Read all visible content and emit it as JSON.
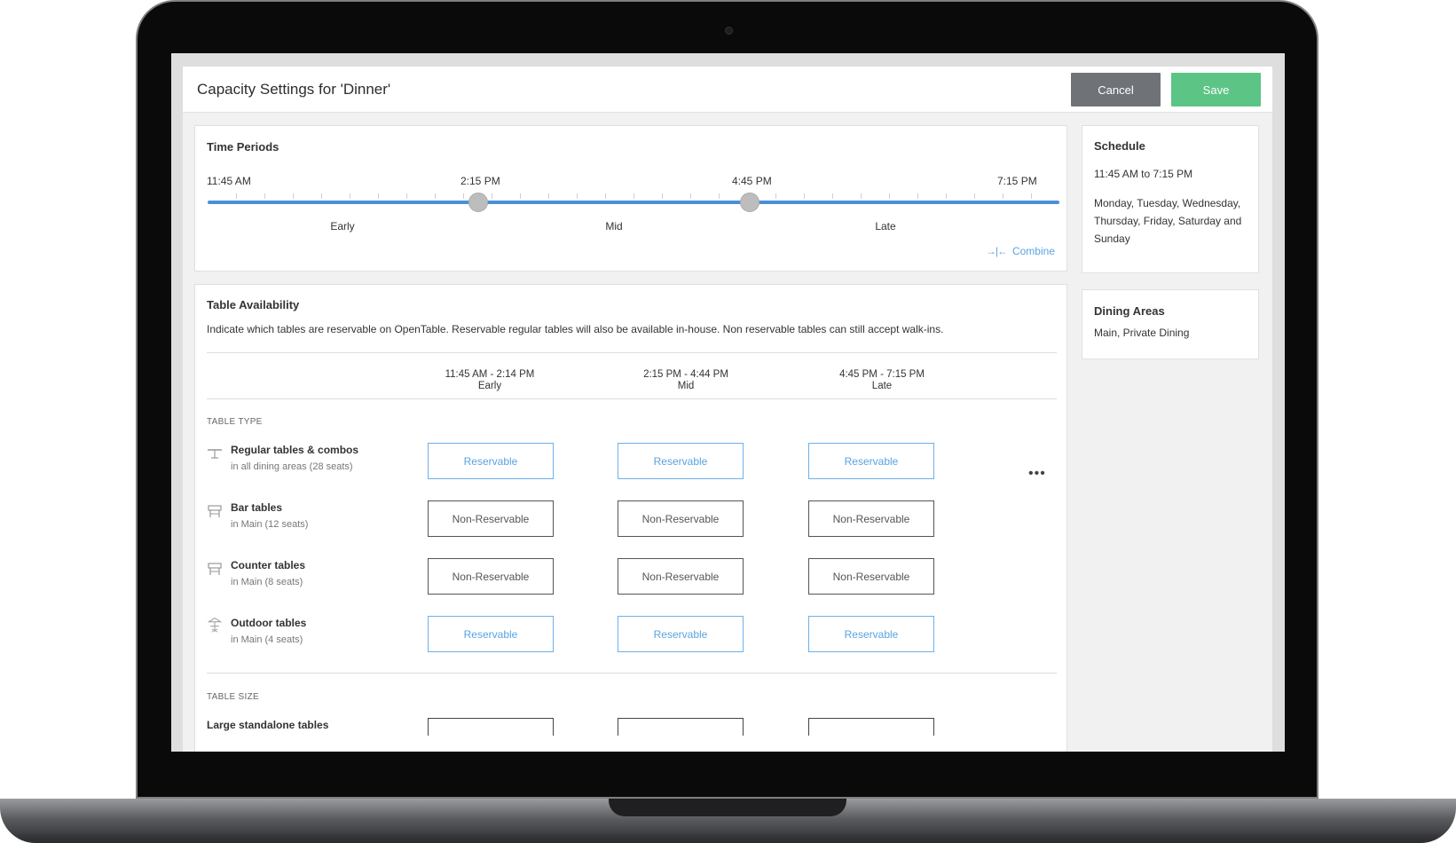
{
  "header": {
    "title": "Capacity Settings for 'Dinner'",
    "cancel_label": "Cancel",
    "save_label": "Save"
  },
  "time_periods": {
    "title": "Time Periods",
    "start_label": "11:45 AM",
    "handle1_label": "2:15 PM",
    "handle2_label": "4:45 PM",
    "end_label": "7:15 PM",
    "periods": [
      "Early",
      "Mid",
      "Late"
    ],
    "combine_label": "Combine"
  },
  "schedule": {
    "title": "Schedule",
    "time_range": "11:45 AM to 7:15 PM",
    "days_line1": "Monday, Tuesday, Wednesday,",
    "days_line2": "Thursday, Friday, Saturday and",
    "days_line3": "Sunday"
  },
  "dining_areas": {
    "title": "Dining Areas",
    "value": "Main, Private Dining"
  },
  "table_availability": {
    "title": "Table Availability",
    "description": "Indicate which tables are reservable on OpenTable. Reservable regular tables will also be available in-house. Non reservable tables can still accept walk-ins.",
    "columns": [
      {
        "time": "11:45 AM - 2:14 PM",
        "period": "Early"
      },
      {
        "time": "2:15 PM - 4:44 PM",
        "period": "Mid"
      },
      {
        "time": "4:45 PM - 7:15 PM",
        "period": "Late"
      }
    ],
    "table_type_label": "TABLE TYPE",
    "rows": [
      {
        "name": "Regular tables & combos",
        "sub": "in all dining areas (28 seats)",
        "values": [
          "Reservable",
          "Reservable",
          "Reservable"
        ]
      },
      {
        "name": "Bar tables",
        "sub": "in Main (12 seats)",
        "values": [
          "Non-Reservable",
          "Non-Reservable",
          "Non-Reservable"
        ]
      },
      {
        "name": "Counter tables",
        "sub": "in Main (8 seats)",
        "values": [
          "Non-Reservable",
          "Non-Reservable",
          "Non-Reservable"
        ]
      },
      {
        "name": "Outdoor tables",
        "sub": "in Main (4 seats)",
        "values": [
          "Reservable",
          "Reservable",
          "Reservable"
        ]
      }
    ],
    "more_label": "•••",
    "table_size_label": "TABLE SIZE",
    "size_rows": [
      {
        "name": "Large standalone tables"
      }
    ]
  },
  "icons": {
    "row_icons": [
      "table-icon",
      "bar-stool-icon",
      "counter-stool-icon",
      "umbrella-table-icon"
    ],
    "combine_icon": "combine-arrows-icon"
  },
  "colors": {
    "accent_blue": "#5aa3e0",
    "save_green": "#5cc485",
    "cancel_gray": "#6f7378",
    "slider_blue": "#4a90d9"
  }
}
